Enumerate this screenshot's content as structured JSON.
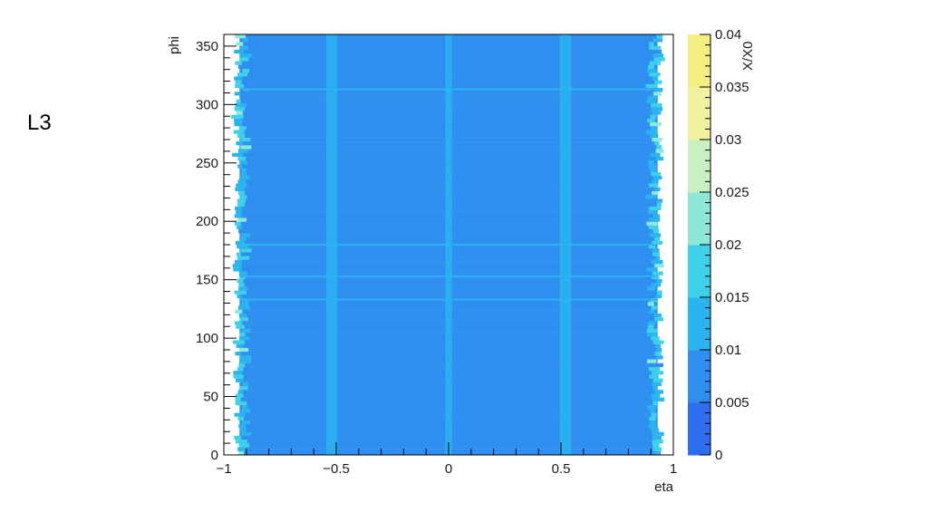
{
  "slide": {
    "label": "L3"
  },
  "chart_data": {
    "type": "heatmap",
    "title": "",
    "xlabel": "eta",
    "ylabel": "phi",
    "zlabel": "X/X0",
    "xlim": [
      -1,
      1
    ],
    "ylim": [
      0,
      360
    ],
    "zlim": [
      0,
      0.04
    ],
    "x_ticks": [
      -1,
      -0.5,
      0,
      0.5,
      1
    ],
    "x_tick_labels": [
      "−1",
      "−0.5",
      "0",
      "0.5",
      "1"
    ],
    "y_ticks": [
      0,
      50,
      100,
      150,
      200,
      250,
      300,
      350
    ],
    "y_tick_labels": [
      "0",
      "50",
      "100",
      "150",
      "200",
      "250",
      "300",
      "350"
    ],
    "z_ticks": [
      0,
      0.005,
      0.01,
      0.015,
      0.02,
      0.025,
      0.03,
      0.035,
      0.04
    ],
    "z_tick_labels": [
      "0",
      "0.005",
      "0.01",
      "0.015",
      "0.02",
      "0.025",
      "0.03",
      "0.035",
      "0.04"
    ],
    "colormap": [
      "#2e6cf0",
      "#2e8ff0",
      "#2ab4f0",
      "#3fd0ea",
      "#8ee8da",
      "#c8f0c0",
      "#f0f2a0",
      "#f5ee80"
    ],
    "background_value": 0.006,
    "coverage_eta": [
      -0.93,
      0.93
    ],
    "features": {
      "eta_bands": [
        {
          "eta": -0.52,
          "width": 0.05,
          "value": 0.01
        },
        {
          "eta": 0.0,
          "width": 0.03,
          "value": 0.011
        },
        {
          "eta": 0.52,
          "width": 0.05,
          "value": 0.01
        }
      ],
      "edge_eta": [
        -0.92,
        0.92
      ],
      "edge_value": 0.014,
      "phi_lines": [
        {
          "phi": 313,
          "value": 0.012
        },
        {
          "phi": 180,
          "value": 0.014
        },
        {
          "phi": 153,
          "value": 0.012
        },
        {
          "phi": 133,
          "value": 0.012
        }
      ]
    },
    "grid": false,
    "legend": "colorbar-right"
  }
}
